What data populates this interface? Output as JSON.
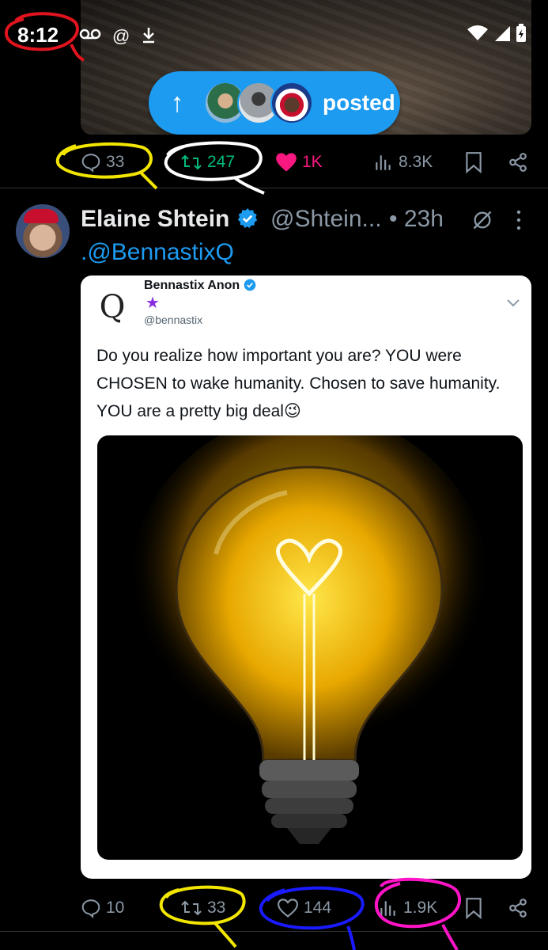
{
  "status_bar": {
    "time": "8:12",
    "icons": [
      "voicemail-icon",
      "at-icon",
      "download-icon"
    ],
    "right_icons": [
      "wifi-icon",
      "signal-icon",
      "battery-icon"
    ]
  },
  "posted_pill": {
    "label": "posted",
    "arrow": "↑"
  },
  "top_post_actions": {
    "replies": "33",
    "reposts": "247",
    "likes": "1K",
    "views": "8.3K",
    "colors": {
      "repost": "#00ba7c",
      "like": "#f91880"
    }
  },
  "tweet": {
    "author_name": "Elaine Shtein",
    "handle": "@Shtein...",
    "time": "• 23h",
    "text": ".@BennastixQ",
    "verified_color": "#1d9bf0"
  },
  "embedded": {
    "logo_letter": "Q",
    "name": "Bennastix Anon",
    "badge": "★",
    "handle": "@bennastix",
    "text": "Do you realize how important you are? YOU were CHOSEN to wake humanity. Chosen to save humanity. YOU are a pretty big deal😉",
    "image_subject": "glowing light bulb with heart filament"
  },
  "tweet_actions": {
    "replies": "10",
    "reposts": "33",
    "likes": "144",
    "views": "1.9K"
  },
  "annotation_colors": {
    "red": "#e0141e",
    "yellow": "#f2e600",
    "white": "#ffffff",
    "blue": "#1a1aff",
    "magenta": "#ff14c8"
  }
}
